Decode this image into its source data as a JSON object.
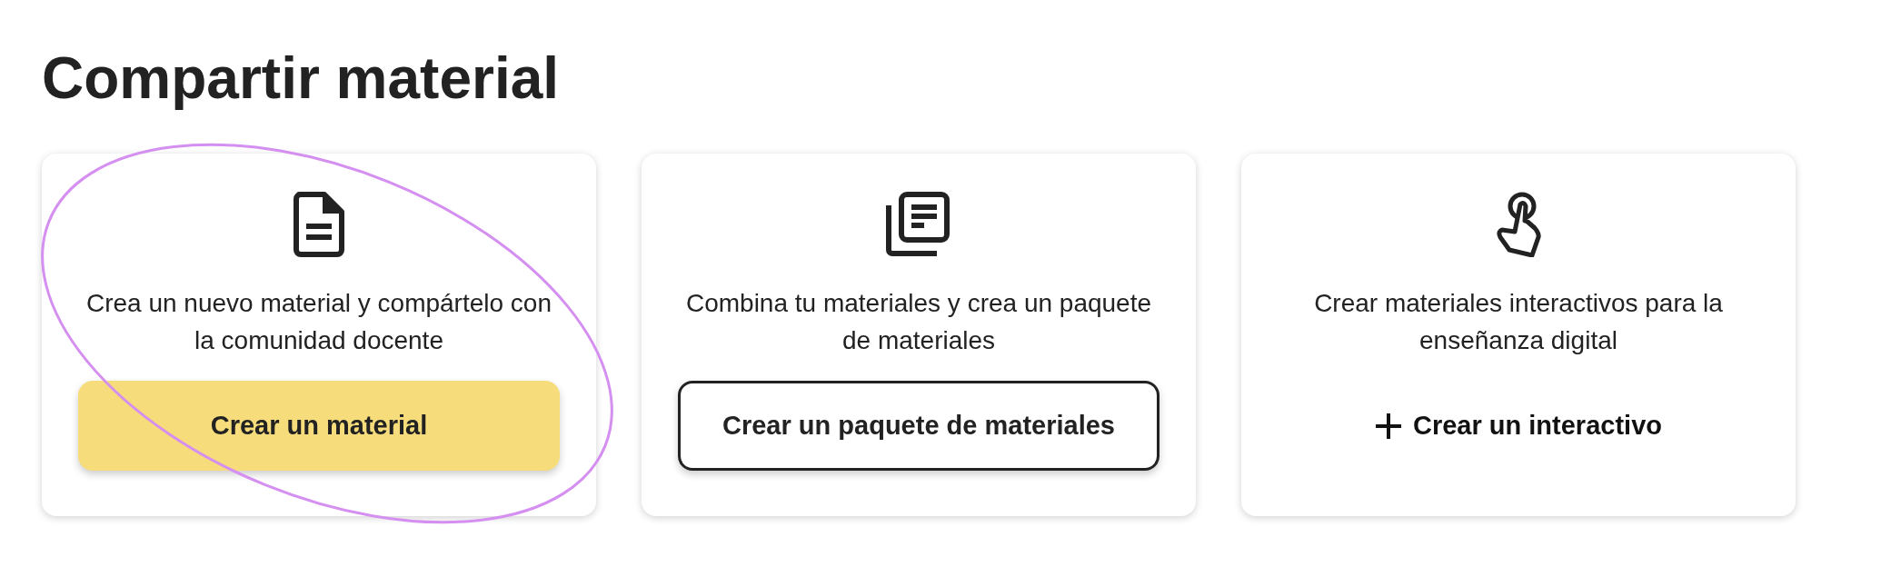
{
  "title": "Compartir material",
  "cards": [
    {
      "description": "Crea un nuevo material y compártelo con la comunidad docente",
      "button": {
        "label": "Crear un material",
        "kind": "filled"
      },
      "highlighted": true
    },
    {
      "description": "Combina tu materiales y crea un paquete de materiales",
      "button": {
        "label": "Crear un paquete de materiales",
        "kind": "outlined"
      },
      "highlighted": false
    },
    {
      "description": "Crear materiales interactivos para la enseñanza digital",
      "button": {
        "label": "Crear un interactivo",
        "kind": "text"
      },
      "highlighted": false
    }
  ]
}
